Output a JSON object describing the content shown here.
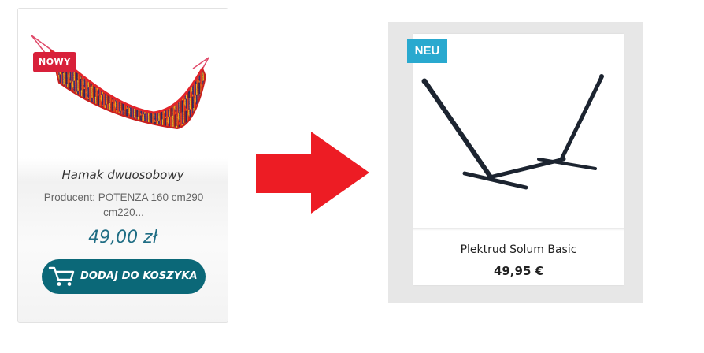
{
  "before_card": {
    "badge": "NOWY",
    "image_icon": "hammock-image",
    "title": "Hamak dwuosobowy",
    "description": "Producent: POTENZA 160 cm290 cm220...",
    "price": "49,00 zł",
    "add_to_cart_label": "DODAJ DO KOSZYKA",
    "cart_icon": "cart-icon",
    "colors": {
      "badge": "#d8203a",
      "price": "#1f6d84",
      "button": "#0b6878"
    }
  },
  "arrow": {
    "icon": "arrow-right-icon",
    "color": "#ed1c24"
  },
  "after_card": {
    "badge": "NEU",
    "image_icon": "hammock-stand-image",
    "title": "Plektrud Solum Basic",
    "price": "49,95 €",
    "colors": {
      "badge": "#29a9cf",
      "panel": "#e7e7e7"
    }
  }
}
